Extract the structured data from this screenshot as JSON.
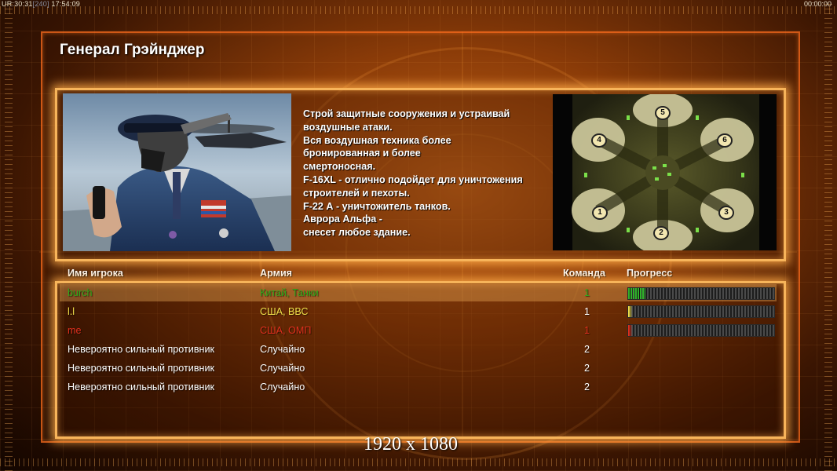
{
  "topbar": {
    "left_prefix": "UR:30:31",
    "left_bracket": "[240]",
    "left_time": "17:54:09",
    "right_timer": "00:00:00"
  },
  "title": "Генерал Грэйнджер",
  "description": [
    "Строй защитные сооружения и устраивай",
    " воздушные атаки.",
    "Вся воздушная техника более",
    " бронированная и более",
    "смертоносная.",
    "F-16XL - отлично подойдет для уничтожения",
    " строителей и пехоты.",
    "F-22 А - уничтожитель танков.",
    "Аврора Альфа -",
    "снесет любое здание."
  ],
  "map": {
    "positions": [
      "5",
      "4",
      "6",
      "1",
      "3",
      "2"
    ]
  },
  "table": {
    "headers": {
      "player": "Имя игрока",
      "army": "Армия",
      "team": "Команда",
      "progress": "Прогресс"
    },
    "rows": [
      {
        "name": "burch",
        "army": "Китай, Танки",
        "team": "1",
        "color": "#2fa81a",
        "progress": 0.12,
        "bar_color": "#2fb32a"
      },
      {
        "name": "l.l",
        "army": "США, ВВС",
        "team": "1",
        "color": "#f2e14a",
        "progress": 0.015,
        "bar_color": "#f2e14a"
      },
      {
        "name": "me",
        "army": "США, ОМП",
        "team": "1",
        "color": "#e0301e",
        "progress": 0.015,
        "bar_color": "#e0301e"
      },
      {
        "name": "Невероятно сильный противник",
        "army": "Случайно",
        "team": "2",
        "color": "#ffffff"
      },
      {
        "name": "Невероятно сильный противник",
        "army": "Случайно",
        "team": "2",
        "color": "#ffffff"
      },
      {
        "name": "Невероятно сильный противник",
        "army": "Случайно",
        "team": "2",
        "color": "#ffffff"
      }
    ]
  },
  "watermark": "1920 x 1080",
  "colors": {
    "panel_border": "#f7b45a",
    "frame": "#ff6e1e"
  }
}
